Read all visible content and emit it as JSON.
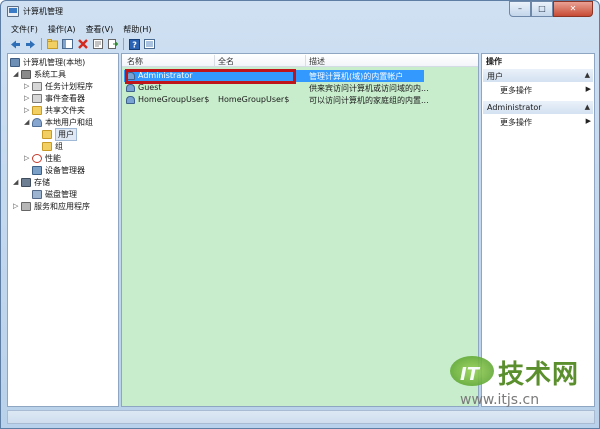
{
  "window": {
    "title": "计算机管理"
  },
  "caption_buttons": {
    "minimize": "–",
    "maximize": "□",
    "close": "✕"
  },
  "menu": [
    "文件(F)",
    "操作(A)",
    "查看(V)",
    "帮助(H)"
  ],
  "toolbar_icons": [
    "back-arrow-icon",
    "forward-arrow-icon",
    "up-folder-icon",
    "show-hide-tree-icon",
    "delete-icon",
    "properties-icon",
    "export-icon",
    "help-icon",
    "view-icon"
  ],
  "tree": {
    "root": "计算机管理(本地)",
    "items": [
      {
        "label": "系统工具",
        "expand": "◢",
        "icon": "tools-icon"
      },
      {
        "label": "任务计划程序",
        "expand": "▷",
        "icon": "task-scheduler-icon"
      },
      {
        "label": "事件查看器",
        "expand": "▷",
        "icon": "event-viewer-icon"
      },
      {
        "label": "共享文件夹",
        "expand": "▷",
        "icon": "shared-folder-icon"
      },
      {
        "label": "本地用户和组",
        "expand": "◢",
        "icon": "local-users-groups-icon"
      },
      {
        "label": "用户",
        "expand": "",
        "icon": "users-folder-icon"
      },
      {
        "label": "组",
        "expand": "",
        "icon": "groups-folder-icon"
      },
      {
        "label": "性能",
        "expand": "▷",
        "icon": "performance-icon"
      },
      {
        "label": "设备管理器",
        "expand": "",
        "icon": "device-manager-icon"
      },
      {
        "label": "存储",
        "expand": "◢",
        "icon": "storage-icon"
      },
      {
        "label": "磁盘管理",
        "expand": "",
        "icon": "disk-management-icon"
      },
      {
        "label": "服务和应用程序",
        "expand": "▷",
        "icon": "services-apps-icon"
      }
    ]
  },
  "list": {
    "columns": [
      "名称",
      "全名",
      "描述"
    ],
    "rows": [
      {
        "name": "Administrator",
        "full_name": "",
        "description": "管理计算机(域)的内置帐户",
        "selected": true
      },
      {
        "name": "Guest",
        "full_name": "",
        "description": "供来宾访问计算机或访问域的内...",
        "selected": false
      },
      {
        "name": "HomeGroupUser$",
        "full_name": "HomeGroupUser$",
        "description": "可以访问计算机的家庭组的内置...",
        "selected": false
      }
    ]
  },
  "actions": {
    "title": "操作",
    "sections": [
      {
        "header": "用户",
        "more": "更多操作"
      },
      {
        "header": "Administrator",
        "more": "更多操作"
      }
    ],
    "collapse_glyph": "▲",
    "more_glyph": "▶"
  },
  "colors": {
    "list_background": "#c8edcc",
    "selection": "#3399ff",
    "highlight_box": "#c0141b"
  },
  "watermark": {
    "logo": "IT",
    "name": "技术网",
    "url": "www.itjs.cn"
  }
}
